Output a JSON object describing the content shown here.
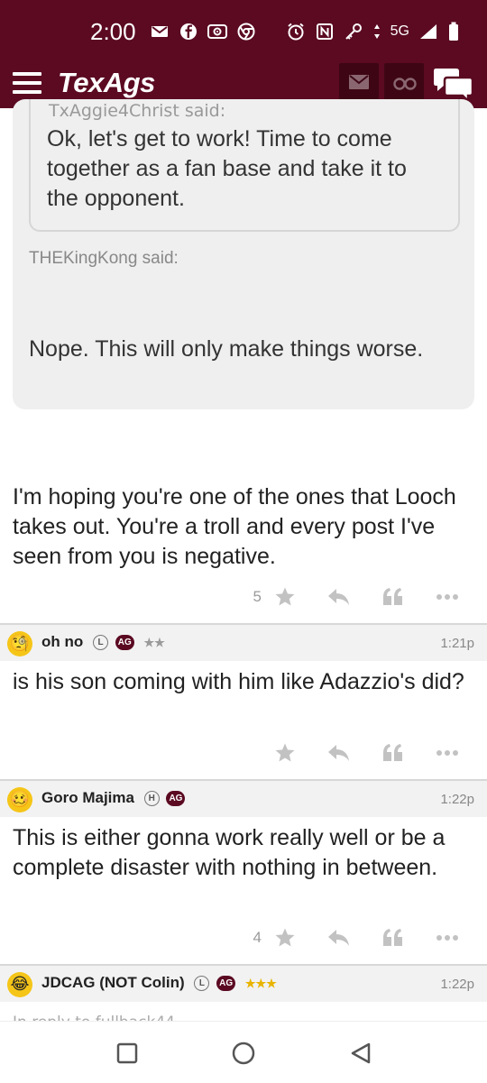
{
  "status_bar": {
    "time": "2:00",
    "network": "5G",
    "icons_left": [
      "mail-icon",
      "facebook-icon",
      "radio-icon",
      "chrome-icon"
    ],
    "icons_right": [
      "alarm-icon",
      "nfc-icon",
      "key-icon",
      "data-arrows-icon",
      "signal-icon",
      "battery-icon"
    ]
  },
  "app_bar": {
    "logo": "TexAgs",
    "buttons": [
      "menu-icon",
      "mail-icon",
      "binoculars-icon",
      "chat-icon"
    ]
  },
  "quote": {
    "inner_author_cut": "TxAggie4Christ said:",
    "inner_text": "Ok, let's get to work! Time to come together as a fan base and take it to the opponent.",
    "outer_author": "THEKingKong said:",
    "outer_text": "Nope. This will only make things worse."
  },
  "posts": [
    {
      "body": "I'm hoping you're one of the ones that Looch takes out. You're a troll and every post I've seen from you is negative.",
      "likes": "5"
    },
    {
      "username": "oh no",
      "badge_letter": "L",
      "badge_ag": "AG",
      "stars": "★★",
      "time": "1:21p",
      "body": "is his son coming with him like Adazzio's did?",
      "likes": ""
    },
    {
      "username": "Goro Majima",
      "badge_letter": "H",
      "badge_ag": "AG",
      "stars": "",
      "time": "1:22p",
      "body": "This is either gonna work really well or be a complete disaster with nothing in between.",
      "likes": "4"
    },
    {
      "username": "JDCAG (NOT Colin)",
      "badge_letter": "L",
      "badge_ag": "AG",
      "stars": "★★★",
      "time": "1:22p",
      "reply_cut": "In reply to fullback44"
    }
  ],
  "nav_bar": [
    "recents-square-icon",
    "home-circle-icon",
    "back-triangle-icon"
  ],
  "colors": {
    "brand": "#5b0a22",
    "quote_bg": "#efefef",
    "star_gold": "#e8b400"
  }
}
